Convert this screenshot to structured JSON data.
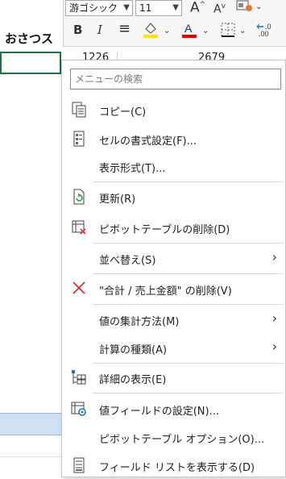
{
  "sheet": {
    "label": "おさつス",
    "cell_values": [
      "1226",
      "2679"
    ]
  },
  "toolbar": {
    "font_name": "游ゴシック",
    "font_size": "11",
    "grow_font": "A",
    "shrink_font": "A",
    "bold": "B",
    "italic": "I",
    "align": "≡",
    "fill_color": "#ffe600",
    "font_color": "#e00000"
  },
  "menu": {
    "search_placeholder": "メニューの検索",
    "items": [
      {
        "label": "コピー(C)",
        "icon": "copy-icon"
      },
      {
        "label": "セルの書式設定(F)...",
        "icon": "format-cells-icon"
      },
      {
        "label": "表示形式(T)...",
        "icon": ""
      },
      {
        "label": "更新(R)",
        "icon": "refresh-icon"
      },
      {
        "label": "ピボットテーブルの削除(D)",
        "icon": "delete-pivot-icon"
      },
      {
        "label": "並べ替え(S)",
        "icon": "",
        "submenu": true
      },
      {
        "label": "\"合計 / 売上金額\" の削除(V)",
        "icon": "remove-field-icon"
      },
      {
        "label": "値の集計方法(M)",
        "icon": "",
        "submenu": true
      },
      {
        "label": "計算の種類(A)",
        "icon": "",
        "submenu": true
      },
      {
        "label": "詳細の表示(E)",
        "icon": "show-details-icon"
      },
      {
        "label": "値フィールドの設定(N)...",
        "icon": "field-settings-icon"
      },
      {
        "label": "ピボットテーブル オプション(O)...",
        "icon": ""
      },
      {
        "label": "フィールド リストを表示する(D)",
        "icon": "field-list-icon"
      }
    ]
  }
}
